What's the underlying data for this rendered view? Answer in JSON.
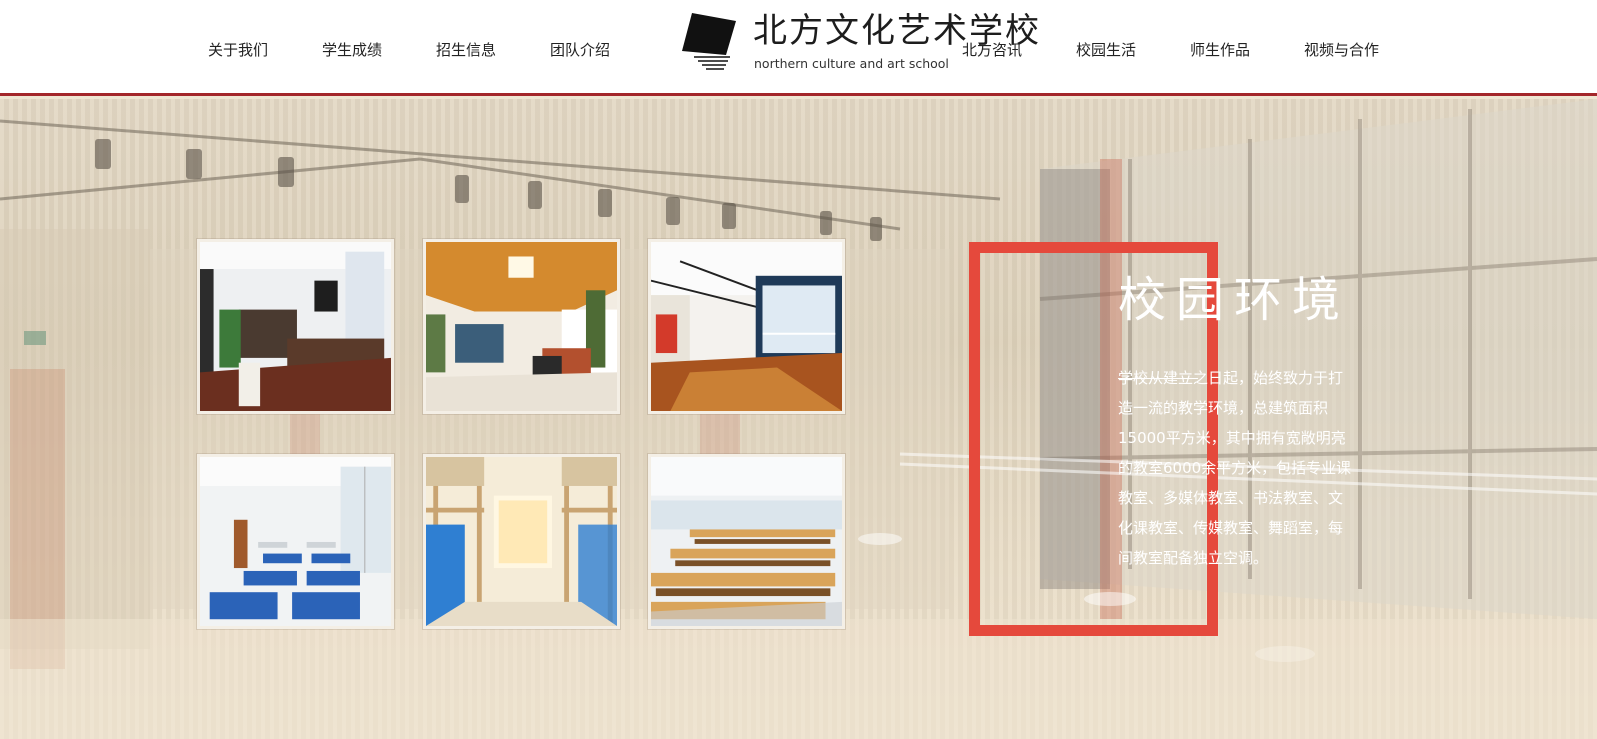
{
  "nav": {
    "left": [
      {
        "label": "关于我们"
      },
      {
        "label": "学生成绩"
      },
      {
        "label": "招生信息"
      },
      {
        "label": "团队介绍"
      }
    ],
    "right": [
      {
        "label": "北方咨讯"
      },
      {
        "label": "校园生活"
      },
      {
        "label": "师生作品"
      },
      {
        "label": "视频与合作"
      }
    ]
  },
  "logo": {
    "cn": "北方文化艺术学校",
    "en": "northern culture and art school"
  },
  "section": {
    "title": "校园环境",
    "body": "学校从建立之日起，始终致力于打造一流的教学环境，总建筑面积15000平方米，其中拥有宽敞明亮的教室6000余平方米，包括专业课教室、多媒体教室、书法教室、文化课教室、传媒教室、舞蹈室，每间教室配备独立空调。"
  },
  "gallery": [
    {
      "icon": "office-photo-icon"
    },
    {
      "icon": "lounge-photo-icon"
    },
    {
      "icon": "dance-studio-photo-icon"
    },
    {
      "icon": "classroom-photo-icon"
    },
    {
      "icon": "dormitory-photo-icon"
    },
    {
      "icon": "cafeteria-photo-icon"
    }
  ],
  "colors": {
    "accent_red": "#e5493c",
    "header_border": "#a3262a",
    "background": "#e3d8c4"
  }
}
